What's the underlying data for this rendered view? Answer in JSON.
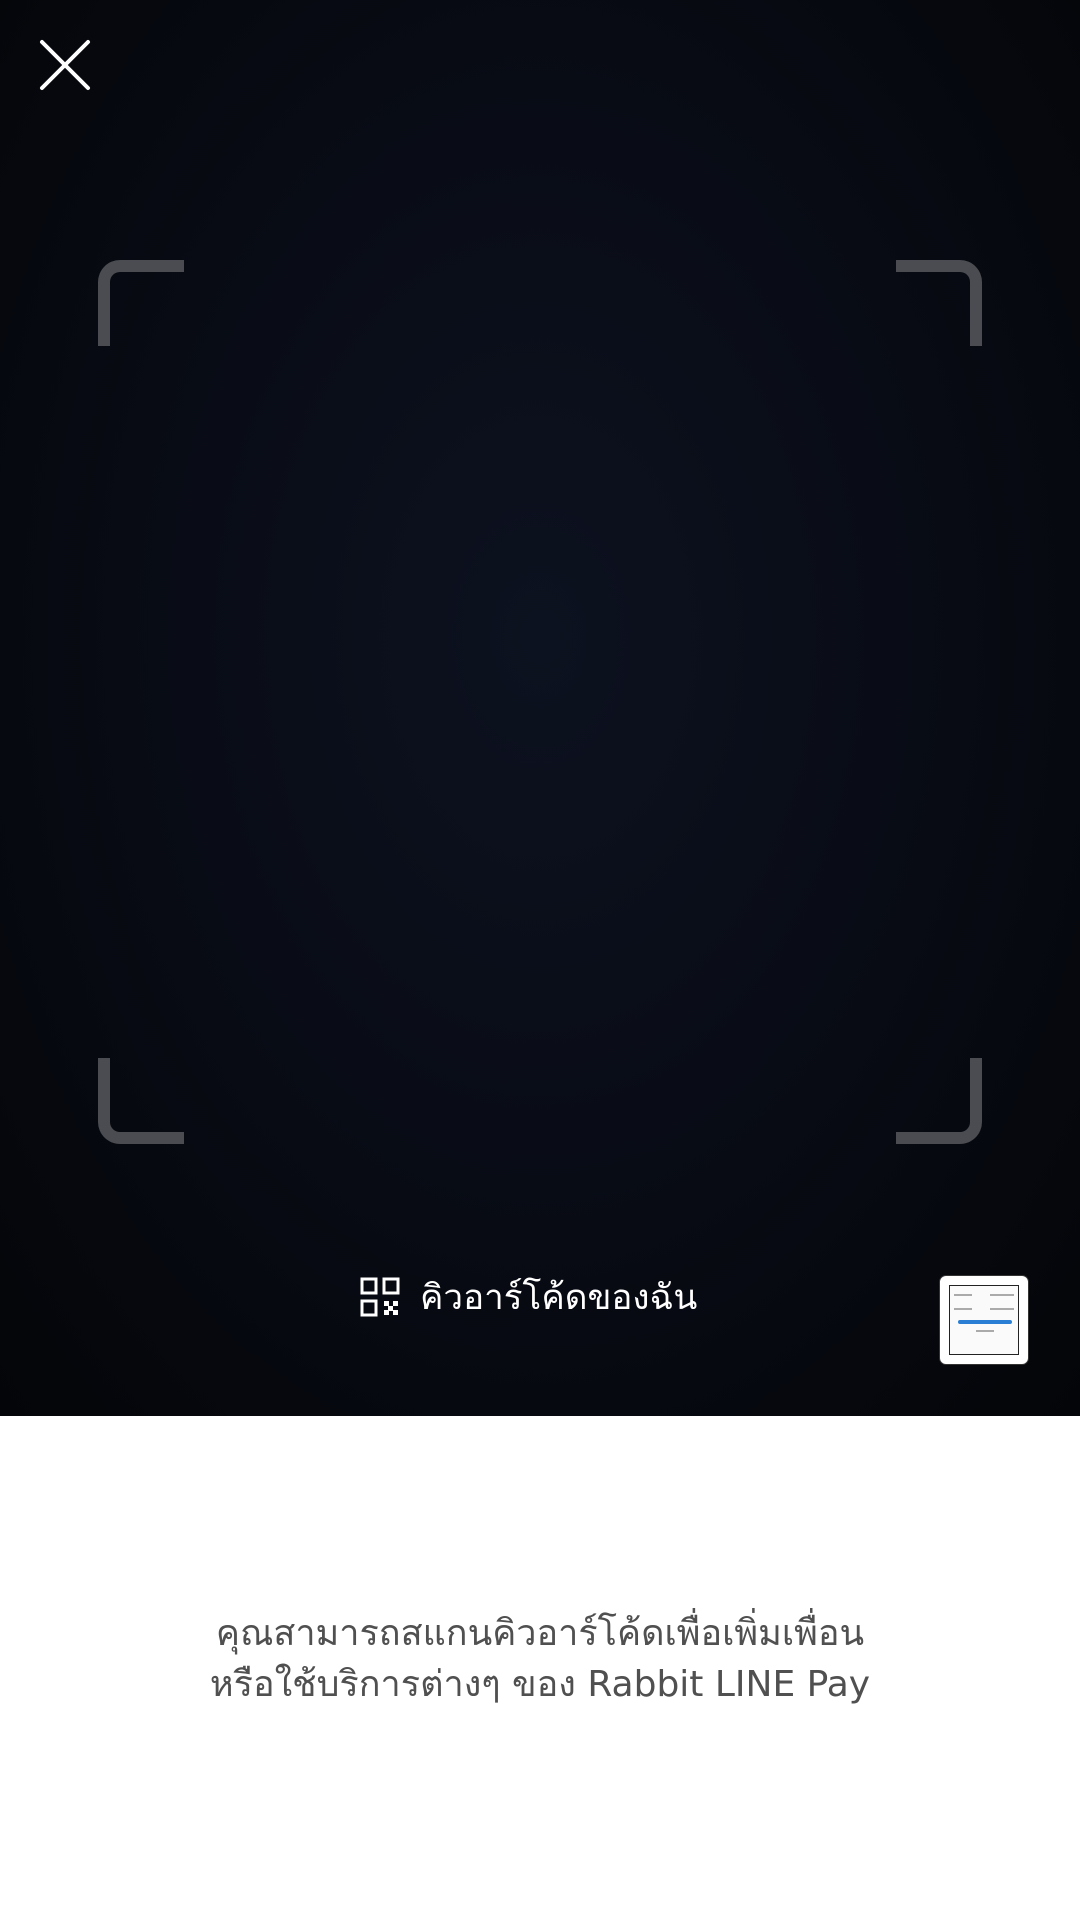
{
  "scanner": {
    "close_icon": "close-icon",
    "my_qr_icon": "qr-code-icon",
    "my_qr_label": "คิวอาร์โค้ดของฉัน",
    "gallery_icon": "image-thumbnail"
  },
  "info": {
    "line1": "คุณสามารถสแกนคิวอาร์โค้ดเพื่อเพิ่มเพื่อน",
    "line2": "หรือใช้บริการต่างๆ ของ Rabbit LINE Pay"
  },
  "colors": {
    "camera_background": "#080b14",
    "frame_corner": "#4a4c52",
    "panel_background": "#ffffff",
    "info_text": "#505050"
  }
}
